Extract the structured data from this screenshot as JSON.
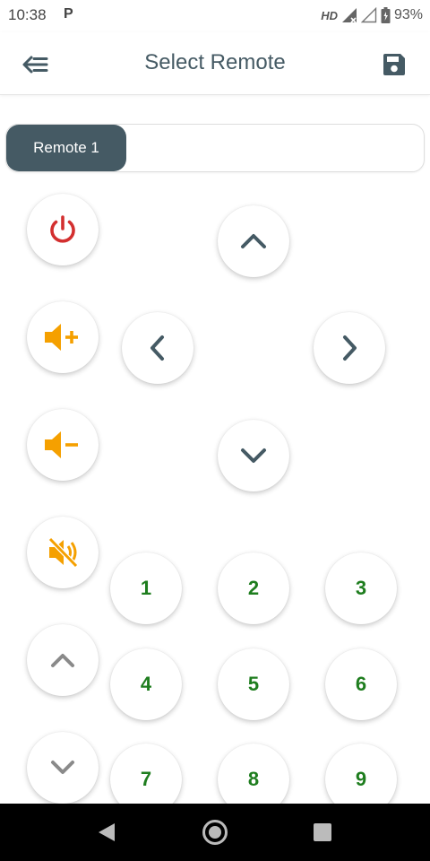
{
  "status_bar": {
    "time": "10:38",
    "carrier_icon": "P",
    "network": "HD",
    "battery": "93%"
  },
  "app_bar": {
    "title": "Select Remote",
    "back_icon": "back-arrow-icon",
    "save_icon": "save-icon"
  },
  "remotes": {
    "selected": "Remote 1"
  },
  "controls": {
    "power_icon": "power-icon",
    "volume_up_icon": "volume-up-icon",
    "volume_down_icon": "volume-down-icon",
    "mute_icon": "mute-icon",
    "channel_up_icon": "chevron-up-icon",
    "channel_down_icon": "chevron-down-icon"
  },
  "dpad": {
    "up_icon": "chevron-up-icon",
    "left_icon": "chevron-left-icon",
    "right_icon": "chevron-right-icon",
    "down_icon": "chevron-down-icon"
  },
  "keypad": [
    "1",
    "2",
    "3",
    "4",
    "5",
    "6",
    "7",
    "8",
    "9"
  ],
  "colors": {
    "primary": "#455a64",
    "power": "#d32f2f",
    "volume": "#f5a000",
    "number": "#1e7d1e",
    "channel": "#8a8a8a"
  }
}
